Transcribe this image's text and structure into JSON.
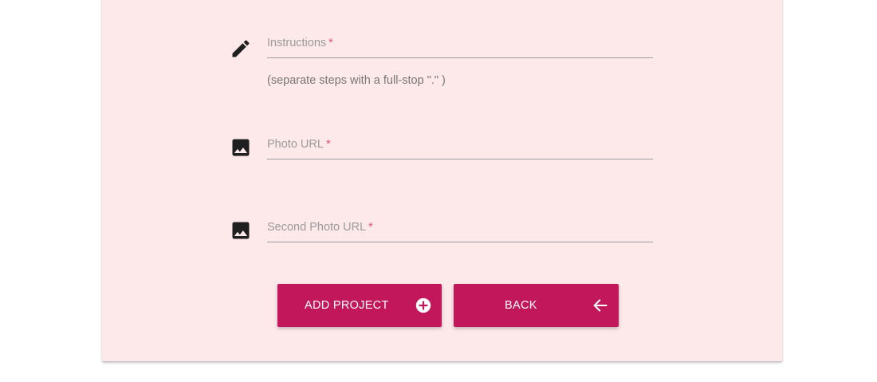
{
  "form": {
    "instructions": {
      "icon": "pencil-icon",
      "label": "Instructions",
      "required_mark": "*",
      "helper": "(separate steps with a full-stop \".\" )"
    },
    "photo_url": {
      "icon": "image-icon",
      "label": "Photo URL",
      "required_mark": "*"
    },
    "second_photo_url": {
      "icon": "image-icon",
      "label": "Second Photo URL",
      "required_mark": "*"
    }
  },
  "actions": {
    "add_project": {
      "label": "ADD PROJECT",
      "icon": "add-circle-icon"
    },
    "back": {
      "label": "BACK",
      "icon": "arrow-left-icon"
    }
  },
  "colors": {
    "card_background": "#fde8ea",
    "button_background": "#c2185b",
    "required_mark": "#e2566f"
  }
}
